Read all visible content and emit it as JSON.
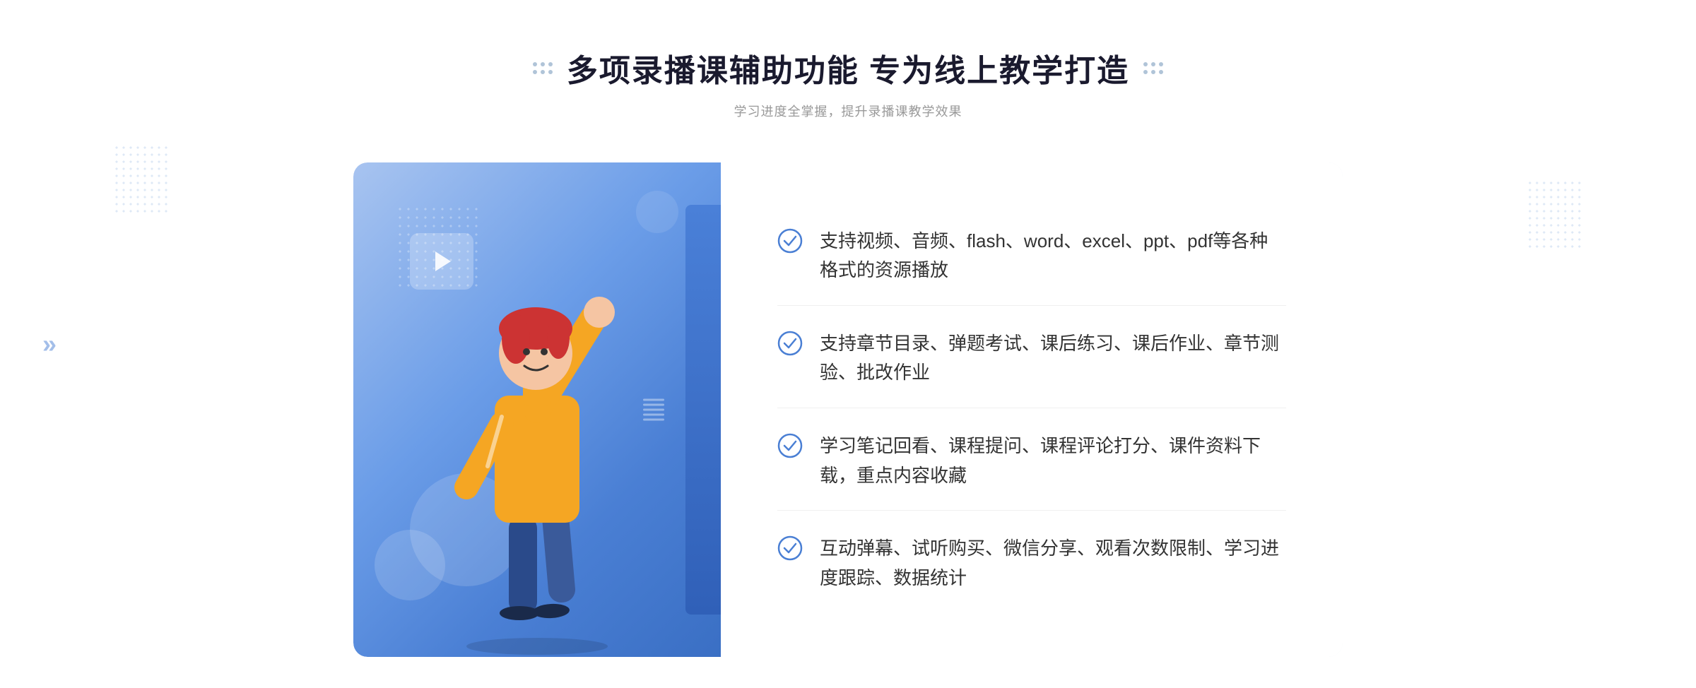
{
  "header": {
    "main_title": "多项录播课辅助功能 专为线上教学打造",
    "subtitle": "学习进度全掌握，提升录播课教学效果"
  },
  "features": [
    {
      "id": 1,
      "text": "支持视频、音频、flash、word、excel、ppt、pdf等各种格式的资源播放"
    },
    {
      "id": 2,
      "text": "支持章节目录、弹题考试、课后练习、课后作业、章节测验、批改作业"
    },
    {
      "id": 3,
      "text": "学习笔记回看、课程提问、课程评论打分、课件资料下载，重点内容收藏"
    },
    {
      "id": 4,
      "text": "互动弹幕、试听购买、微信分享、观看次数限制、学习进度跟踪、数据统计"
    }
  ],
  "icons": {
    "check": "check-circle-icon",
    "chevron_left": "«",
    "play": "play-icon"
  },
  "colors": {
    "primary_blue": "#4a7fd4",
    "light_blue": "#7aaae8",
    "check_color": "#4a7fd4",
    "title_color": "#1a1a2e",
    "subtitle_color": "#999999",
    "text_color": "#333333"
  }
}
